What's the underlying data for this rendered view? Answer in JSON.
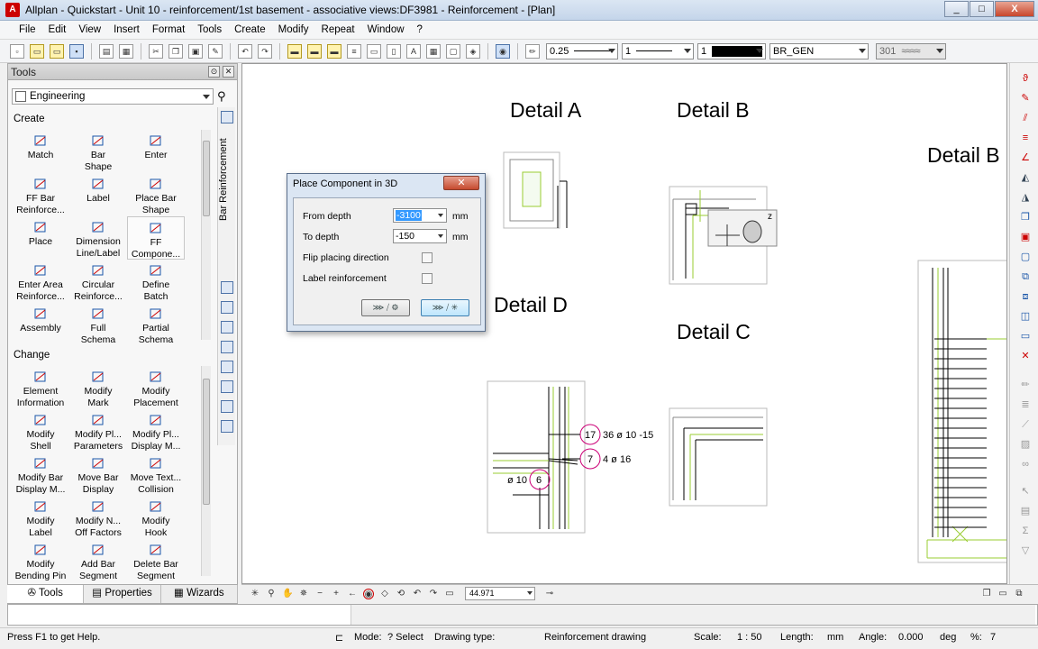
{
  "window": {
    "title": "Allplan - Quickstart - Unit 10 - reinforcement/1st basement - associative views:DF3981 - Reinforcement - [Plan]",
    "minimize": "_",
    "maximize": "□",
    "close": "X"
  },
  "menu": [
    "File",
    "Edit",
    "View",
    "Insert",
    "Format",
    "Tools",
    "Create",
    "Modify",
    "Repeat",
    "Window",
    "?"
  ],
  "toolbar": {
    "pen_thickness": "0.25",
    "line_type": "1",
    "color": "1",
    "layer": "BR_GEN",
    "pattern": "301"
  },
  "tools_panel": {
    "title": "Tools",
    "module": "Engineering",
    "vertical_tab": "Bar Reinforcement",
    "create_label": "Create",
    "change_label": "Change",
    "create_items": [
      [
        "Match",
        ""
      ],
      [
        "Bar",
        "Shape"
      ],
      [
        "Enter",
        ""
      ],
      [
        "FF Bar",
        "Reinforce..."
      ],
      [
        "Label",
        ""
      ],
      [
        "Place Bar",
        "Shape"
      ],
      [
        "Place",
        ""
      ],
      [
        "Dimension",
        "Line/Label"
      ],
      [
        "FF",
        "Compone..."
      ],
      [
        "Enter Area",
        "Reinforce..."
      ],
      [
        "Circular",
        "Reinforce..."
      ],
      [
        "Define",
        "Batch"
      ],
      [
        "Assembly",
        ""
      ],
      [
        "Full",
        "Schema"
      ],
      [
        "Partial",
        "Schema"
      ]
    ],
    "change_items": [
      [
        "Element",
        "Information"
      ],
      [
        "Modify",
        "Mark"
      ],
      [
        "Modify",
        "Placement"
      ],
      [
        "Modify",
        "Shell"
      ],
      [
        "Modify Pl...",
        "Parameters"
      ],
      [
        "Modify Pl...",
        "Display M..."
      ],
      [
        "Modify Bar",
        "Display M..."
      ],
      [
        "Move Bar",
        "Display"
      ],
      [
        "Move Text...",
        "Collision"
      ],
      [
        "Modify",
        "Label"
      ],
      [
        "Modify N...",
        "Off Factors"
      ],
      [
        "Modify",
        "Hook"
      ],
      [
        "Modify",
        "Bending Pin"
      ],
      [
        "Add Bar",
        "Segment"
      ],
      [
        "Delete Bar",
        "Segment"
      ]
    ],
    "tabs": [
      "Tools",
      "Properties",
      "Wizards"
    ]
  },
  "drawing": {
    "labels": {
      "detail_a": "Detail A",
      "detail_b": "Detail B",
      "detail_b2": "Detail B",
      "detail_c": "Detail C",
      "detail_d": "Detail D"
    },
    "annotations": {
      "mark17": "17",
      "text17": "36 ø 10 -15",
      "mark7": "7",
      "text7": "4 ø 16",
      "text6": "ø 10",
      "mark6": "6",
      "z_axis": "z"
    }
  },
  "dialog": {
    "title": "Place Component in 3D",
    "close": "✕",
    "from_depth_label": "From depth",
    "from_depth_value": "-3100",
    "to_depth_label": "To depth",
    "to_depth_value": "-150",
    "unit": "mm",
    "flip_label": "Flip placing direction",
    "label_reinf_label": "Label reinforcement"
  },
  "viewbar": {
    "zoom": "44.971"
  },
  "status": {
    "help": "Press F1 to get Help.",
    "mode_label": "Mode:",
    "mode_value": "? Select",
    "drawing_type_label": "Drawing type:",
    "drawing_type_value": "Reinforcement drawing",
    "scale_label": "Scale:",
    "scale_value": "1 : 50",
    "length_label": "Length:",
    "length_unit": "mm",
    "angle_label": "Angle:",
    "angle_value": "0.000",
    "angle_unit": "deg",
    "percent_label": "%:",
    "percent_value": "7"
  },
  "colors": {
    "accent": "#3399ff",
    "close_red": "#c64a2e",
    "annotation_magenta": "#cc0077",
    "rebar_green": "#9acd32"
  }
}
